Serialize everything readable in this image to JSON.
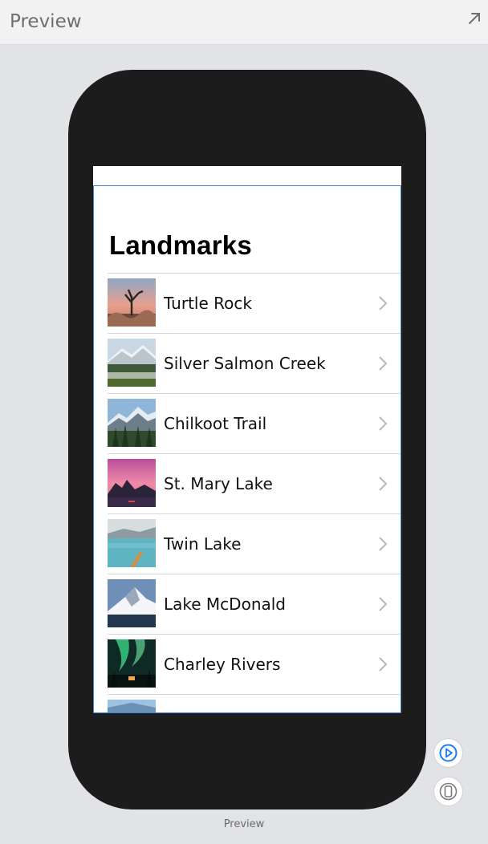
{
  "panel": {
    "title": "Preview"
  },
  "app": {
    "nav_title": "Landmarks",
    "landmarks": [
      {
        "name": "Turtle Rock",
        "image": "desert-joshua-tree"
      },
      {
        "name": "Silver Salmon Creek",
        "image": "snowy-mountain-meadow"
      },
      {
        "name": "Chilkoot Trail",
        "image": "mountain-forest"
      },
      {
        "name": "St. Mary Lake",
        "image": "pink-sunset-lake"
      },
      {
        "name": "Twin Lake",
        "image": "turquoise-lake-canoe"
      },
      {
        "name": "Lake McDonald",
        "image": "snowy-peak-lake"
      },
      {
        "name": "Charley Rivers",
        "image": "aurora-night"
      },
      {
        "name": "",
        "image": "partial-sky"
      }
    ]
  },
  "footer": {
    "label": "Preview"
  },
  "icons": {
    "expand": "expand-icon",
    "play": "live-preview-play-icon",
    "device": "device-icon"
  },
  "colors": {
    "accent": "#1a7cf5",
    "selection": "#3a86d6",
    "device": "#1c1c1c"
  }
}
